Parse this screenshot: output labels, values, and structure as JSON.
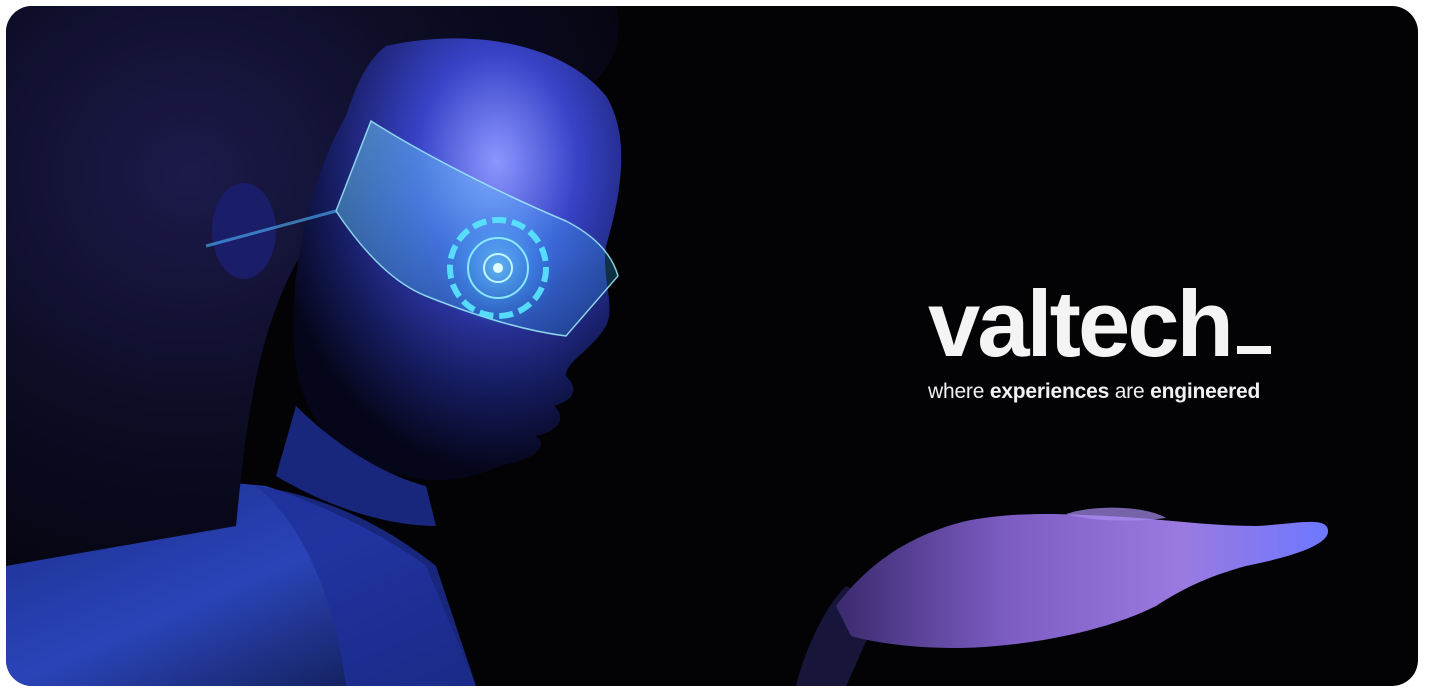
{
  "banner": {
    "logo_text": "valtech",
    "tagline": {
      "where": "where",
      "experiences": "experiences",
      "are": "are",
      "engineered": "engineered"
    }
  },
  "colors": {
    "background": "#030306",
    "text": "#f4f4f4",
    "glow": "#37c8ff",
    "skin_light": "#6a77ff"
  }
}
